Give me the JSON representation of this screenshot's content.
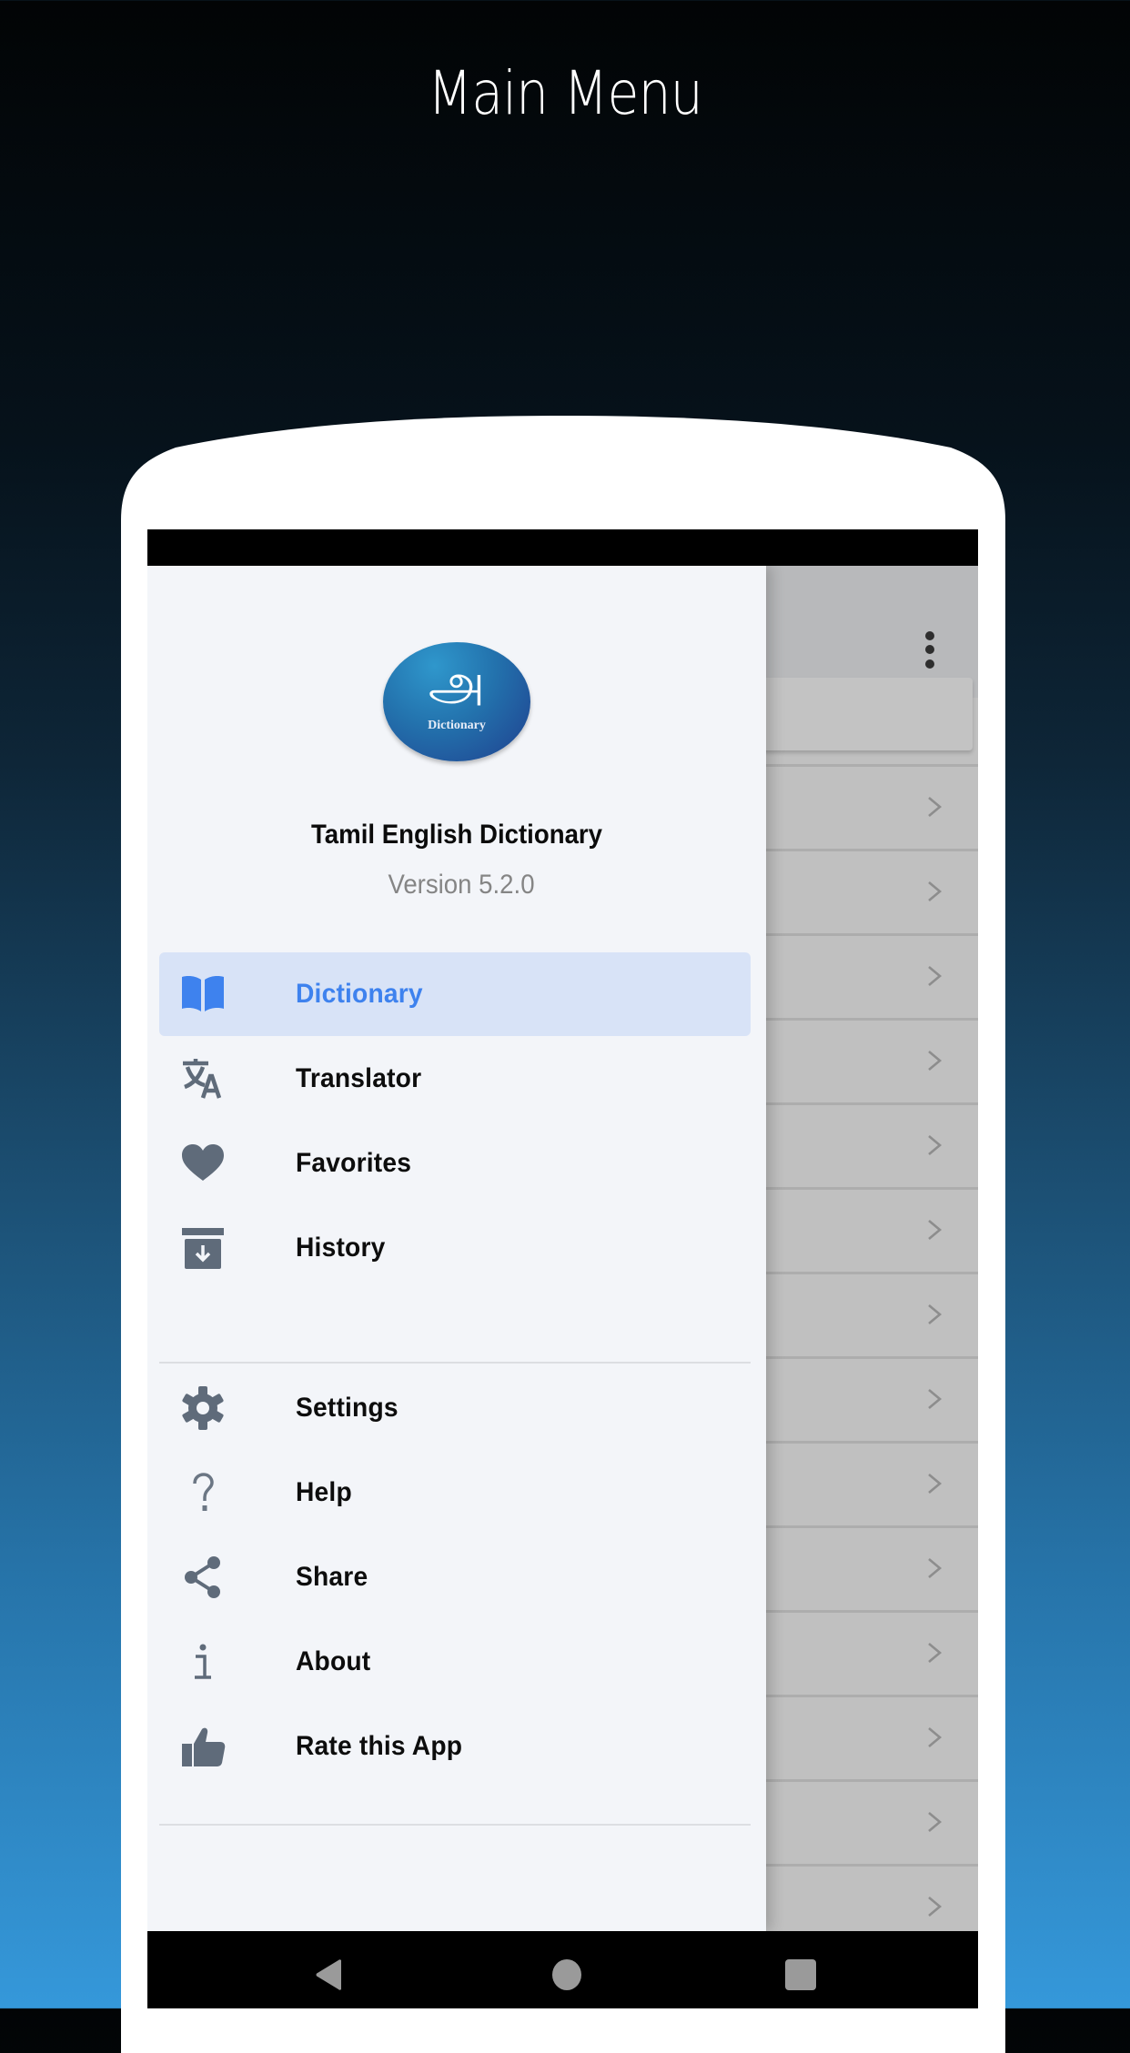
{
  "promo": {
    "title": "Main Menu"
  },
  "colors": {
    "accent": "#3e82ee",
    "selected_bg": "#d8e3f7",
    "icon_gray": "#5f6b7a",
    "drawer_bg": "#f3f5f9"
  },
  "drawer": {
    "header": {
      "logo_letter": "அ",
      "logo_caption": "Dictionary",
      "app_name": "Tamil English Dictionary",
      "version": "Version 5.2.0"
    },
    "primary_items": [
      {
        "label": "Dictionary",
        "icon": "book-icon",
        "selected": true
      },
      {
        "label": "Translator",
        "icon": "translate-icon",
        "selected": false
      },
      {
        "label": "Favorites",
        "icon": "heart-icon",
        "selected": false
      },
      {
        "label": "History",
        "icon": "archive-icon",
        "selected": false
      }
    ],
    "secondary_items": [
      {
        "label": "Settings",
        "icon": "gear-icon"
      },
      {
        "label": "Help",
        "icon": "help-icon"
      },
      {
        "label": "Share",
        "icon": "share-icon"
      },
      {
        "label": "About",
        "icon": "info-icon"
      },
      {
        "label": "Rate this App",
        "icon": "thumbs-up-icon"
      }
    ]
  },
  "background_app": {
    "toolbar_menu_icon": "more-vert-icon",
    "list_row_count": 14,
    "row_icon": "chevron-right-icon"
  },
  "nav_bar": {
    "buttons": [
      "back-icon",
      "home-icon",
      "recents-icon"
    ]
  }
}
